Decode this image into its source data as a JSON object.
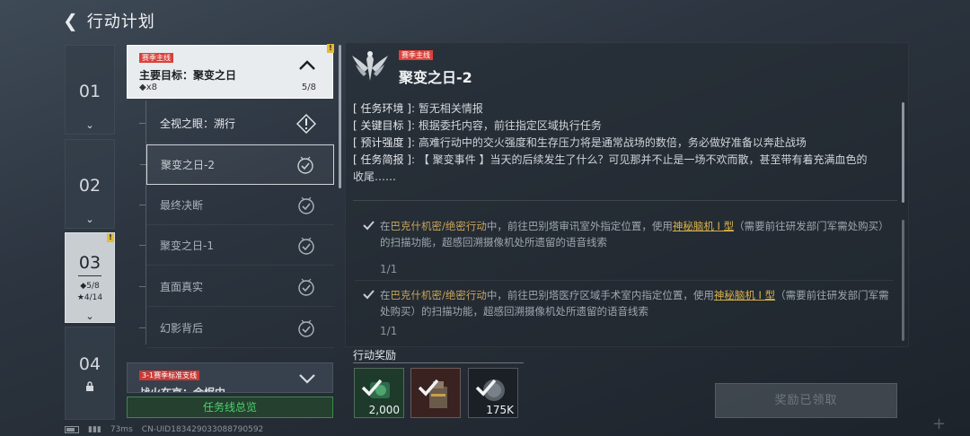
{
  "header": {
    "back_icon": "chevron-left-icon",
    "title": "行动计划"
  },
  "chapters": [
    {
      "num": "01",
      "expanded": false
    },
    {
      "num": "02",
      "expanded": false
    },
    {
      "num": "03",
      "diamond": "◆5/8",
      "star": "★4/14",
      "active": true
    },
    {
      "num": "04",
      "locked": true
    }
  ],
  "main_quest": {
    "tag": "赛季主线",
    "name": "主要目标：聚变之日",
    "count": "◆x8",
    "progress": "5/8"
  },
  "quests": [
    {
      "label": "全视之眼：溯行",
      "icon": "alert-diamond-icon"
    },
    {
      "label": "聚变之日-2",
      "icon": "check-medal-icon",
      "selected": true
    },
    {
      "label": "最终决断",
      "icon": "check-medal-icon"
    },
    {
      "label": "聚变之日-1",
      "icon": "check-medal-icon"
    },
    {
      "label": "直面真实",
      "icon": "check-medal-icon"
    },
    {
      "label": "幻影背后",
      "icon": "check-medal-icon"
    }
  ],
  "side_quest": {
    "tag": "3-1赛季标准支线",
    "name": "战火在京：余烬中"
  },
  "overview_button": "任务线总览",
  "detail": {
    "tag": "赛季主线",
    "title": "聚变之日-2",
    "env_key": "[ 任务环境 ]",
    "env_val": ":  暂无相关情报",
    "target_key": "[ 关键目标 ]",
    "target_val": ":  根据委托内容，前往指定区域执行任务",
    "intensity_key": "[ 预计强度 ]",
    "intensity_val": ":  高难行动中的交火强度和生存压力将是通常战场的数倍，务必做好准备以奔赴战场",
    "brief_key": "[ 任务简报 ]",
    "brief_val": ":  【 聚变事件 】当天的后续发生了什么？可见那并不止是一场不欢而散，甚至带有着充满血色的",
    "brief_val2": "收尾……",
    "objectives": [
      {
        "pre": "在",
        "hl": "巴克什机密/绝密行动",
        "mid": "中，前往巴别塔审讯室外指定位置，使用",
        "link": "神秘脑机 I 型",
        "post": "（需要前往研发部门军需处购买）的扫描功能，超感回溯摄像机处所遗留的语音线索",
        "count": "1/1"
      },
      {
        "pre": "在",
        "hl": "巴克什机密/绝密行动",
        "mid": "中，前往巴别塔医疗区域手术室内指定位置，使用",
        "link": "神秘脑机 I 型",
        "post": "（需要前往研发部门军需处购买）的扫描功能，超感回溯摄像机处所遗留的语音线索",
        "count": "1/1"
      }
    ]
  },
  "rewards": {
    "label": "行动奖励",
    "items": [
      {
        "count": "2,000",
        "icon": "currency-icon"
      },
      {
        "count": "",
        "icon": "item-box-icon"
      },
      {
        "count": "175K",
        "icon": "coin-icon"
      }
    ],
    "claimed_button": "奖励已领取"
  },
  "status": {
    "ping": "73ms",
    "uid": "CN-UID183429033088790592"
  },
  "colors": {
    "accent_green": "#49d36c",
    "tag_red": "#d9423b",
    "highlight_gold": "#c9a55a"
  }
}
